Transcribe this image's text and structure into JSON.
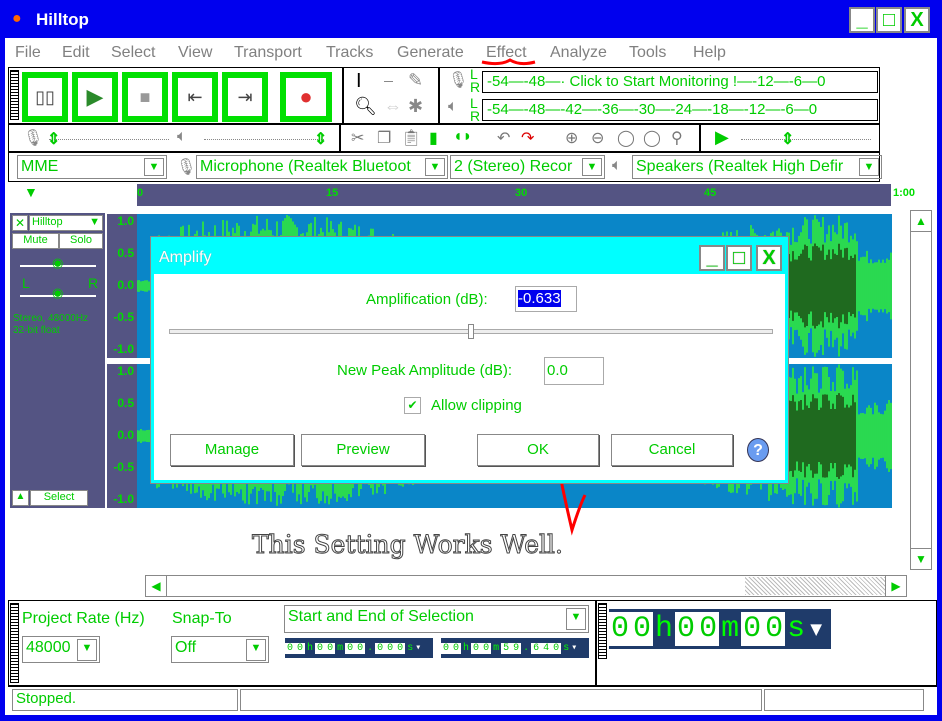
{
  "window": {
    "title": "Hilltop",
    "minimize": "_",
    "maximize": "□",
    "close": "X"
  },
  "menu": [
    "File",
    "Edit",
    "Select",
    "View",
    "Transport",
    "Tracks",
    "Generate",
    "Effect",
    "Analyze",
    "Tools",
    "Help"
  ],
  "transport": {
    "buttons": [
      "pause",
      "play",
      "stop",
      "skip-to-start",
      "skip-to-end",
      "record"
    ]
  },
  "meters": {
    "record_scale": "-54—-48—· Click to Start Monitoring !—-12—-6—0",
    "playback_scale": "-54—-48—-42—-36—-30—-24—-18—-12—-6—0",
    "L": "L",
    "R": "R"
  },
  "devices": {
    "host": "MME",
    "input": "Microphone (Realtek Bluetoot",
    "channels": "2 (Stereo) Recor",
    "output": "Speakers (Realtek High Defir"
  },
  "ruler": {
    "ticks": [
      "0",
      "15",
      "30",
      "45",
      "1:00"
    ]
  },
  "track": {
    "name": "Hilltop",
    "mute": "Mute",
    "solo": "Solo",
    "gain_minus": "-",
    "gain_plus": "+",
    "pan_l": "L",
    "pan_r": "R",
    "info1": "Stereo, 48000Hz",
    "info2": "32-bit float",
    "select": "Select",
    "axis": [
      "1.0",
      "0.5",
      "0.0",
      "-0.5",
      "-1.0"
    ]
  },
  "dialog": {
    "title": "Amplify",
    "amplification_label": "Amplification (dB):",
    "amplification_value": "-0.633",
    "peak_label": "New Peak Amplitude (dB):",
    "peak_value": "0.0",
    "allow_clipping": "Allow clipping",
    "allow_clipping_checked": true,
    "slider_fraction": 0.5,
    "manage": "Manage",
    "preview": "Preview",
    "ok": "OK",
    "cancel": "Cancel",
    "help": "?"
  },
  "annotation": {
    "text": "This Setting Works Well.",
    "color": "#ff0000"
  },
  "selection": {
    "project_rate_label": "Project Rate (Hz)",
    "project_rate": "48000",
    "snap_label": "Snap-To",
    "snap": "Off",
    "mode": "Start and End of Selection",
    "start": [
      "0",
      "0",
      "h",
      "0",
      "0",
      "m",
      "0",
      "0",
      ".",
      "0",
      "0",
      "0",
      "s"
    ],
    "end": [
      "0",
      "0",
      "h",
      "0",
      "0",
      "m",
      "5",
      "9",
      ".",
      "6",
      "4",
      "0",
      "s"
    ]
  },
  "time": {
    "digits": [
      "0",
      "0",
      "h",
      "0",
      "0",
      "m",
      "0",
      "0",
      "s"
    ]
  },
  "status": {
    "text": "Stopped."
  },
  "colors": {
    "accent": "#00cc00",
    "titlebar": "#0000ee",
    "dialog_title": "#00ffff",
    "wave_bg": "#0a86c8",
    "selection": "#0000ee"
  }
}
